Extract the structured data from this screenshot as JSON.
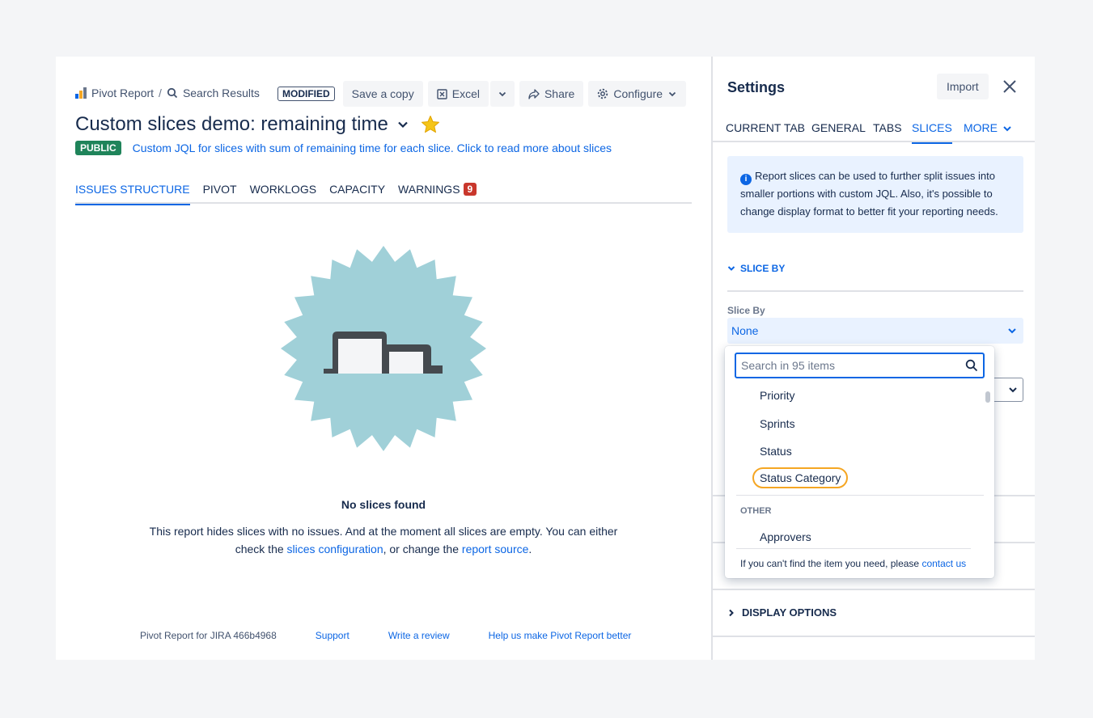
{
  "breadcrumb": {
    "app": "Pivot Report",
    "separator": "/",
    "search": "Search Results"
  },
  "toolbar": {
    "modified_badge": "MODIFIED",
    "save_copy": "Save a copy",
    "excel": "Excel",
    "share": "Share",
    "configure": "Configure"
  },
  "report": {
    "title": "Custom slices demo: remaining time",
    "visibility": "PUBLIC",
    "description": "Custom JQL for slices with sum of remaining time for each slice. Click to read more about slices"
  },
  "tabs": [
    {
      "label": "ISSUES STRUCTURE",
      "active": true
    },
    {
      "label": "PIVOT"
    },
    {
      "label": "WORKLOGS"
    },
    {
      "label": "CAPACITY"
    },
    {
      "label": "WARNINGS",
      "count": "9"
    }
  ],
  "empty_state": {
    "title": "No slices found",
    "text_1": "This report hides slices with no issues. And at the moment all slices are empty. You can either check the ",
    "link_1": "slices configuration",
    "text_2": ", or change the ",
    "link_2": "report source",
    "text_3": "."
  },
  "footer": {
    "version": "Pivot Report for JIRA 466b4968",
    "support": "Support",
    "review": "Write a review",
    "feedback": "Help us make Pivot Report better"
  },
  "settings": {
    "title": "Settings",
    "import": "Import",
    "tabs": [
      {
        "label": "CURRENT TAB"
      },
      {
        "label": "GENERAL"
      },
      {
        "label": "TABS"
      },
      {
        "label": "SLICES",
        "active": true
      },
      {
        "label": "MORE"
      }
    ],
    "info": "Report slices can be used to further split issues into smaller portions with custom JQL. Also, it's possible to change display format to better fit your reporting needs.",
    "section_slice_by": "SLICE BY",
    "slice_by_label": "Slice By",
    "slice_by_value": "None",
    "display_options": "DISPLAY OPTIONS"
  },
  "dropdown": {
    "search_placeholder": "Search in 95 items",
    "items": [
      "Priority",
      "Sprints",
      "Status",
      "Status Category"
    ],
    "highlighted": "Status Category",
    "other_section": "OTHER",
    "other_items": [
      "Approvers"
    ],
    "footer_text": "If you can't find the item you need, please ",
    "footer_link": "contact us"
  },
  "colors": {
    "accent": "#0c66e4",
    "public_badge": "#1f845a",
    "warning_badge": "#c9372c",
    "illustration": "#a0d0d8",
    "highlight_ring": "#f5a623"
  }
}
